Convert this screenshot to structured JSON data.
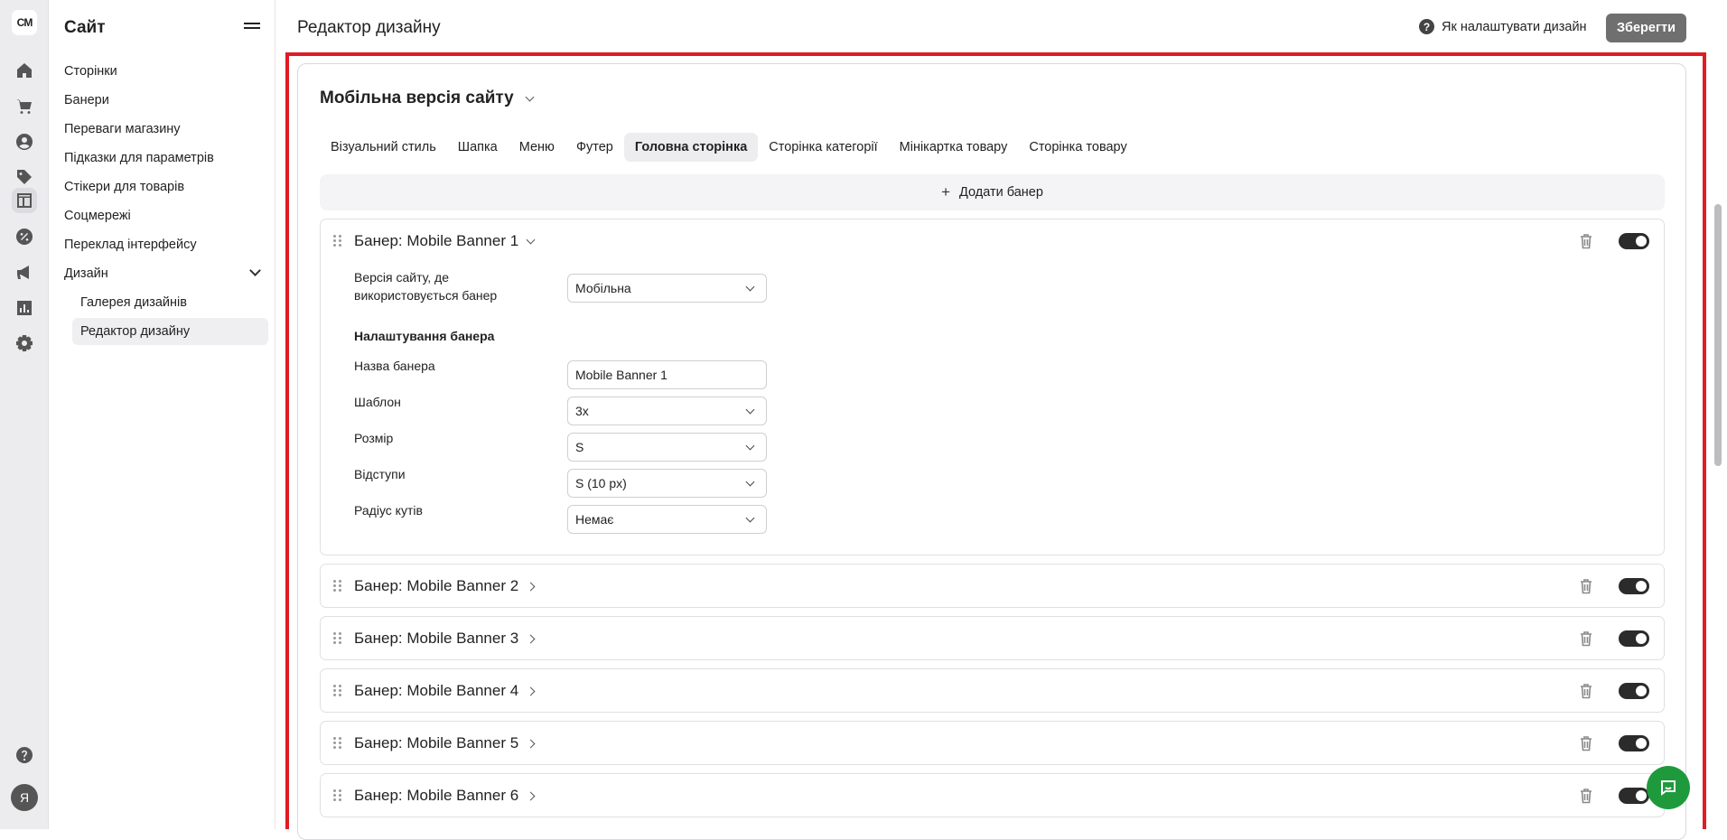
{
  "rail": {
    "logo": "CM",
    "icons": [
      "home-icon",
      "cart-icon",
      "user-icon",
      "tag-icon",
      "layout-icon",
      "percent-icon",
      "megaphone-icon",
      "chart-icon",
      "settings-icon"
    ],
    "help_icon": "help-icon",
    "avatar_letter": "Я"
  },
  "sidebar": {
    "title": "Сайт",
    "items": [
      {
        "label": "Сторінки"
      },
      {
        "label": "Банери"
      },
      {
        "label": "Переваги магазину"
      },
      {
        "label": "Підказки для параметрів"
      },
      {
        "label": "Стікери для товарів"
      },
      {
        "label": "Соцмережі"
      },
      {
        "label": "Переклад інтерфейсу"
      },
      {
        "label": "Дизайн"
      }
    ],
    "subitems": [
      {
        "label": "Галерея дизайнів"
      },
      {
        "label": "Редактор дизайну"
      }
    ]
  },
  "topbar": {
    "title": "Редактор дизайну",
    "help_label": "Як налаштувати дизайн",
    "save_label": "Зберегти"
  },
  "editor": {
    "version_label": "Мобільна версія сайту",
    "tabs": [
      {
        "label": "Візуальний стиль"
      },
      {
        "label": "Шапка"
      },
      {
        "label": "Меню"
      },
      {
        "label": "Футер"
      },
      {
        "label": "Головна сторінка"
      },
      {
        "label": "Сторінка категорії"
      },
      {
        "label": "Мінікартка товару"
      },
      {
        "label": "Сторінка товару"
      }
    ],
    "active_tab": "Головна сторінка",
    "add_banner_label": "Додати банер",
    "expanded_banner": {
      "title": "Банер: Mobile Banner 1",
      "site_version_label": "Версія сайту, де використовується банер",
      "site_version_value": "Мобільна",
      "settings_title": "Налаштування банера",
      "name_label": "Назва банера",
      "name_value": "Mobile Banner 1",
      "template_label": "Шаблон",
      "template_value": "3x",
      "size_label": "Розмір",
      "size_value": "S",
      "padding_label": "Відступи",
      "padding_value": "S (10 px)",
      "radius_label": "Радіус кутів",
      "radius_value": "Немає",
      "enabled": true
    },
    "collapsed_banners": [
      {
        "title": "Банер: Mobile Banner 2",
        "enabled": true
      },
      {
        "title": "Банер: Mobile Banner 3",
        "enabled": true
      },
      {
        "title": "Банер: Mobile Banner 4",
        "enabled": true
      },
      {
        "title": "Банер: Mobile Banner 5",
        "enabled": true
      },
      {
        "title": "Банер: Mobile Banner 6",
        "enabled": true
      }
    ]
  },
  "colors": {
    "highlight": "#e01b24",
    "save_button": "#6f6f6f",
    "toggle_on": "#2b2b2b",
    "chat_button": "#1e9a3c"
  }
}
